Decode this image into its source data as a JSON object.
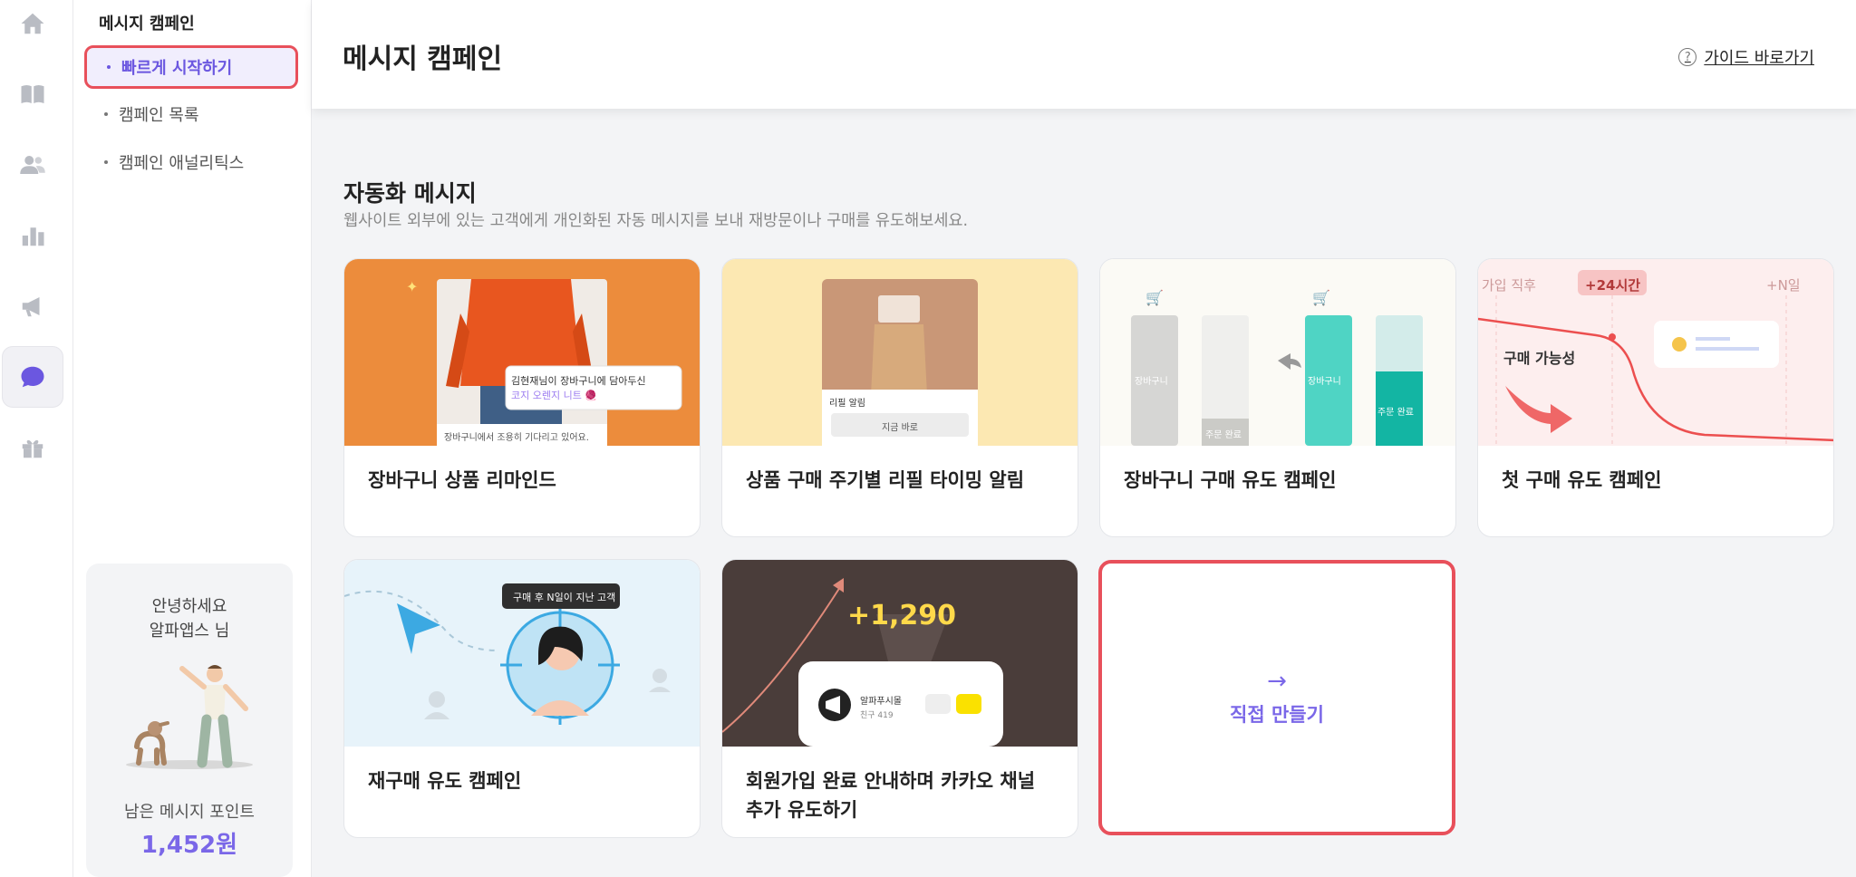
{
  "rail": {
    "icons": [
      "home-icon",
      "book-icon",
      "users-icon",
      "bar-chart-icon",
      "megaphone-icon",
      "chat-bubble-icon",
      "gift-icon"
    ],
    "active": "chat-bubble-icon"
  },
  "subnav": {
    "title": "메시지 캠페인",
    "items": [
      {
        "label": "빠르게 시작하기",
        "active": true
      },
      {
        "label": "캠페인 목록",
        "active": false
      },
      {
        "label": "캠페인 애널리틱스",
        "active": false
      }
    ],
    "greeting_line1": "안녕하세요",
    "greeting_line2": "알파앱스 님",
    "points_label": "남은 메시지 포인트",
    "points_value": "1,452원"
  },
  "header": {
    "title": "메시지 캠페인",
    "guide_link": "가이드 바로가기"
  },
  "section": {
    "title": "자동화 메시지",
    "description": "웹사이트 외부에 있는 고객에게 개인화된 자동 메시지를 보내 재방문이나 구매를 유도해보세요."
  },
  "cards": [
    {
      "label": "장바구니 상품 리마인드",
      "bg": "#ec8c3c",
      "popup_line1": "김현재님이 장바구니에 담아두신",
      "popup_line2": "코지 오렌지 니트 🧶",
      "caption": "장바구니에서 조용히 기다리고 있어요."
    },
    {
      "label": "상품 구매 주기별 리필 타이밍 알림",
      "bg": "#fce8b2",
      "button_text": "지금 바로"
    },
    {
      "label": "장바구니 구매 유도 캠페인",
      "bg": "#fbfaf5",
      "bar_cart": "장바구니",
      "bar_done": "주문 완료"
    },
    {
      "label": "첫 구매 유도 캠페인",
      "bg": "#fdeeee",
      "axis_start": "가입 직후",
      "axis_mid": "+24시간",
      "axis_end": "+N일",
      "curve_label": "구매 가능성"
    },
    {
      "label": "재구매 유도 캠페인",
      "bg": "#e7f3fa",
      "tag": "구매 후 N일이 지난 고객"
    },
    {
      "label": "회원가입 완료 안내하며 카카오 채널 추가 유도하기",
      "bg": "#4a3d3a",
      "counter": "+1,290",
      "channel_name": "알파푸시몰",
      "channel_sub": "친구 419"
    }
  ],
  "make_card": {
    "arrow": "→",
    "label": "직접 만들기"
  },
  "colors": {
    "accent": "#6b57e0",
    "highlight": "#e8505b"
  }
}
